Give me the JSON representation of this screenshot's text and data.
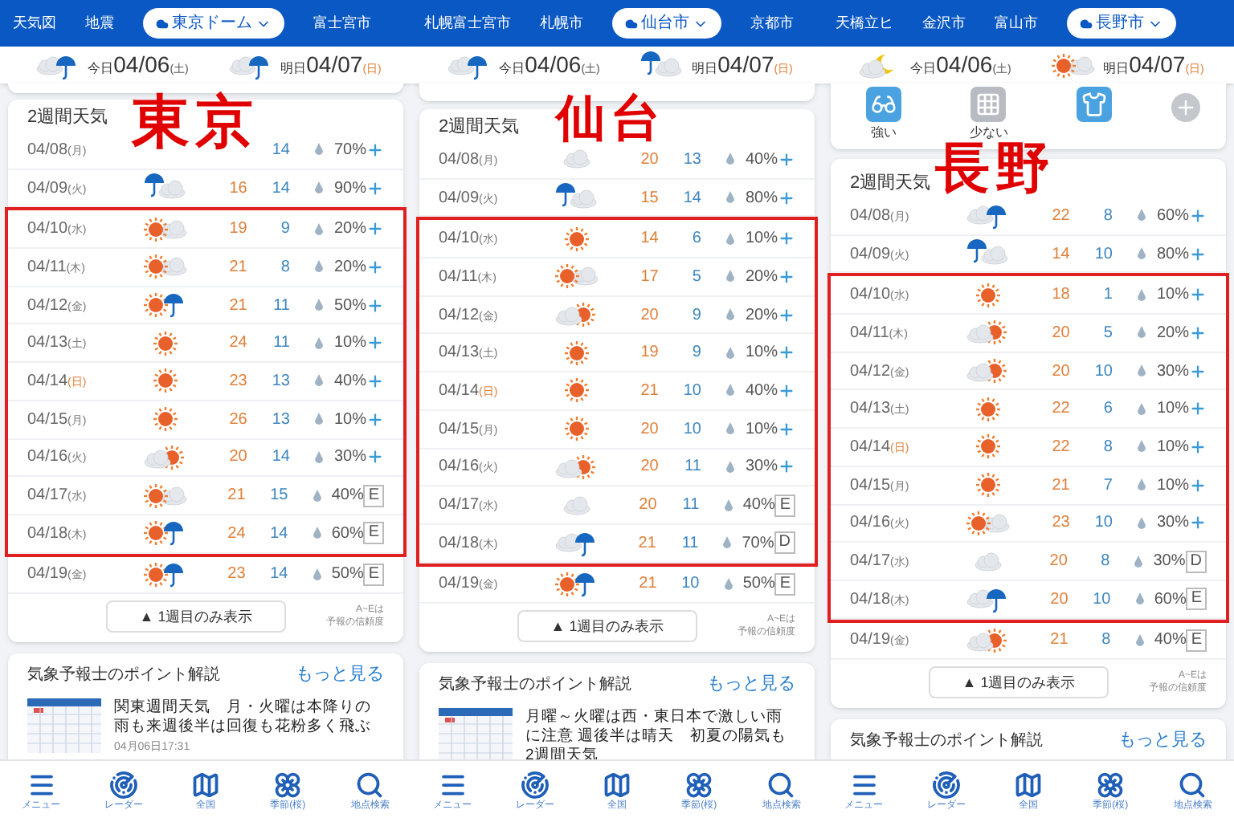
{
  "columns": [
    {
      "city_label": "東京",
      "tabs": [
        {
          "label": "天気図",
          "selected": false
        },
        {
          "label": "地震",
          "selected": false
        },
        {
          "label": "東京ドーム",
          "selected": true
        },
        {
          "label": "富士宮市",
          "selected": false
        }
      ],
      "days": [
        {
          "label": "今日",
          "date": "04/06",
          "weekday": "(土)",
          "holiday": false,
          "kind": "cloud-rain"
        },
        {
          "label": "明日",
          "date": "04/07",
          "weekday": "(日)",
          "holiday": true,
          "kind": "cloud-rain"
        }
      ],
      "forecast": {
        "title": "2週間天気",
        "toggle": "▲ 1週目のみ表示",
        "note": [
          "A~Eは",
          "予報の信頼度"
        ],
        "rows": [
          {
            "date": "04/08",
            "weekday": "(月)",
            "holiday": false,
            "low": "14",
            "rain": "70%"
          },
          {
            "date": "04/09",
            "weekday": "(火)",
            "holiday": false,
            "kind": "rain-cloud",
            "high": "16",
            "low": "14",
            "rain": "90%"
          }
        ],
        "highlighted_rows": [
          {
            "date": "04/10",
            "weekday": "(水)",
            "holiday": false,
            "kind": "sun-cloud",
            "high": "19",
            "low": "9",
            "rain": "20%"
          },
          {
            "date": "04/11",
            "weekday": "(木)",
            "holiday": false,
            "kind": "sun-cloud",
            "high": "21",
            "low": "8",
            "rain": "20%"
          },
          {
            "date": "04/12",
            "weekday": "(金)",
            "holiday": false,
            "kind": "sun-rain",
            "high": "21",
            "low": "11",
            "rain": "50%"
          },
          {
            "date": "04/13",
            "weekday": "(土)",
            "holiday": false,
            "kind": "sun",
            "high": "24",
            "low": "11",
            "rain": "10%"
          },
          {
            "date": "04/14",
            "weekday": "(日)",
            "holiday": true,
            "kind": "sun",
            "high": "23",
            "low": "13",
            "rain": "40%"
          },
          {
            "date": "04/15",
            "weekday": "(月)",
            "holiday": false,
            "kind": "sun",
            "high": "26",
            "low": "13",
            "rain": "10%"
          },
          {
            "date": "04/16",
            "weekday": "(火)",
            "holiday": false,
            "kind": "cloud-sun",
            "high": "20",
            "low": "14",
            "rain": "30%"
          },
          {
            "date": "04/17",
            "weekday": "(水)",
            "holiday": false,
            "kind": "sun-cloud",
            "high": "21",
            "low": "15",
            "rain": "40%",
            "grade": "E"
          },
          {
            "date": "04/18",
            "weekday": "(木)",
            "holiday": false,
            "kind": "sun-rain",
            "high": "24",
            "low": "14",
            "rain": "60%",
            "grade": "E"
          }
        ],
        "later_rows": [
          {
            "date": "04/19",
            "weekday": "(金)",
            "holiday": false,
            "kind": "sun-rain",
            "high": "23",
            "low": "14",
            "rain": "50%",
            "grade": "E"
          }
        ]
      },
      "points": {
        "title": "気象予報士のポイント解説",
        "more": "もっと見る",
        "article": {
          "title": "関東週間天気　月・火曜は本降りの雨も来週後半は回復も花粉多く飛ぶ",
          "date": "04月06日17:31"
        }
      },
      "nav": [
        {
          "label": "メニュー",
          "kind": "menu"
        },
        {
          "label": "レーダー",
          "kind": "radar"
        },
        {
          "label": "全国",
          "kind": "map"
        },
        {
          "label": "季節(桜)",
          "kind": "flower"
        },
        {
          "label": "地点検索",
          "kind": "search"
        }
      ]
    },
    {
      "city_label": "仙台",
      "tabs": [
        {
          "label": "札幌富士宮市",
          "selected": false
        },
        {
          "label": "札幌市",
          "selected": false
        },
        {
          "label": "仙台市",
          "selected": true
        },
        {
          "label": "京都市",
          "selected": false
        }
      ],
      "days": [
        {
          "label": "今日",
          "date": "04/06",
          "weekday": "(土)",
          "holiday": false,
          "kind": "cloud-rain"
        },
        {
          "label": "明日",
          "date": "04/07",
          "weekday": "(日)",
          "holiday": true,
          "kind": "rain-cloud"
        }
      ],
      "forecast": {
        "title": "2週間天気",
        "toggle": "▲ 1週目のみ表示",
        "note": [
          "A~Eは",
          "予報の信頼度"
        ],
        "rows": [
          {
            "date": "04/08",
            "weekday": "(月)",
            "holiday": false,
            "kind": "cloud",
            "high": "20",
            "low": "13",
            "rain": "40%"
          },
          {
            "date": "04/09",
            "weekday": "(火)",
            "holiday": false,
            "kind": "rain-cloud",
            "high": "15",
            "low": "14",
            "rain": "80%"
          }
        ],
        "highlighted_rows": [
          {
            "date": "04/10",
            "weekday": "(水)",
            "holiday": false,
            "kind": "sun",
            "high": "14",
            "low": "6",
            "rain": "10%"
          },
          {
            "date": "04/11",
            "weekday": "(木)",
            "holiday": false,
            "kind": "sun-cloud",
            "high": "17",
            "low": "5",
            "rain": "20%"
          },
          {
            "date": "04/12",
            "weekday": "(金)",
            "holiday": false,
            "kind": "cloud-sun",
            "high": "20",
            "low": "9",
            "rain": "20%"
          },
          {
            "date": "04/13",
            "weekday": "(土)",
            "holiday": false,
            "kind": "sun",
            "high": "19",
            "low": "9",
            "rain": "10%"
          },
          {
            "date": "04/14",
            "weekday": "(日)",
            "holiday": true,
            "kind": "sun",
            "high": "21",
            "low": "10",
            "rain": "40%"
          },
          {
            "date": "04/15",
            "weekday": "(月)",
            "holiday": false,
            "kind": "sun",
            "high": "20",
            "low": "10",
            "rain": "10%"
          },
          {
            "date": "04/16",
            "weekday": "(火)",
            "holiday": false,
            "kind": "cloud-sun",
            "high": "20",
            "low": "11",
            "rain": "30%"
          },
          {
            "date": "04/17",
            "weekday": "(水)",
            "holiday": false,
            "kind": "cloud",
            "high": "20",
            "low": "11",
            "rain": "40%",
            "grade": "E"
          },
          {
            "date": "04/18",
            "weekday": "(木)",
            "holiday": false,
            "kind": "cloud-rain",
            "high": "21",
            "low": "11",
            "rain": "70%",
            "grade": "D"
          }
        ],
        "later_rows": [
          {
            "date": "04/19",
            "weekday": "(金)",
            "holiday": false,
            "kind": "sun-rain",
            "high": "21",
            "low": "10",
            "rain": "50%",
            "grade": "E"
          }
        ]
      },
      "points": {
        "title": "気象予報士のポイント解説",
        "more": "もっと見る",
        "article": {
          "title": "月曜～火曜は西・東日本で激しい雨に注意 週後半は晴天　初夏の陽気も　2週間天気"
        }
      },
      "nav": [
        {
          "label": "メニュー",
          "kind": "menu"
        },
        {
          "label": "レーダー",
          "kind": "radar"
        },
        {
          "label": "全国",
          "kind": "map"
        },
        {
          "label": "季節(桜)",
          "kind": "flower"
        },
        {
          "label": "地点検索",
          "kind": "search"
        }
      ]
    },
    {
      "city_label": "長野",
      "tabs": [
        {
          "label": "天橋立ヒ",
          "selected": false
        },
        {
          "label": "金沢市",
          "selected": false
        },
        {
          "label": "富山市",
          "selected": false
        },
        {
          "label": "長野市",
          "selected": true
        }
      ],
      "days": [
        {
          "label": "今日",
          "date": "04/06",
          "weekday": "(土)",
          "holiday": false,
          "kind": "cloud-moon"
        },
        {
          "label": "明日",
          "date": "04/07",
          "weekday": "(日)",
          "holiday": true,
          "kind": "sun-cloud"
        }
      ],
      "indices": [
        {
          "kind": "glasses",
          "label": "強い"
        },
        {
          "kind": "haze",
          "label": "少ない"
        },
        {
          "kind": "shirt"
        },
        {
          "kind": "add"
        }
      ],
      "forecast": {
        "title": "2週間天気",
        "toggle": "▲ 1週目のみ表示",
        "note": [
          "A~Eは",
          "予報の信頼度"
        ],
        "rows": [
          {
            "date": "04/08",
            "weekday": "(月)",
            "holiday": false,
            "kind": "cloud-rain",
            "high": "22",
            "low": "8",
            "rain": "60%"
          },
          {
            "date": "04/09",
            "weekday": "(火)",
            "holiday": false,
            "kind": "rain-cloud",
            "high": "14",
            "low": "10",
            "rain": "80%"
          }
        ],
        "highlighted_rows": [
          {
            "date": "04/10",
            "weekday": "(水)",
            "holiday": false,
            "kind": "sun",
            "high": "18",
            "low": "1",
            "rain": "10%"
          },
          {
            "date": "04/11",
            "weekday": "(木)",
            "holiday": false,
            "kind": "cloud-sun",
            "high": "20",
            "low": "5",
            "rain": "20%"
          },
          {
            "date": "04/12",
            "weekday": "(金)",
            "holiday": false,
            "kind": "cloud-sun",
            "high": "20",
            "low": "10",
            "rain": "30%"
          },
          {
            "date": "04/13",
            "weekday": "(土)",
            "holiday": false,
            "kind": "sun",
            "high": "22",
            "low": "6",
            "rain": "10%"
          },
          {
            "date": "04/14",
            "weekday": "(日)",
            "holiday": true,
            "kind": "sun",
            "high": "22",
            "low": "8",
            "rain": "10%"
          },
          {
            "date": "04/15",
            "weekday": "(月)",
            "holiday": false,
            "kind": "sun",
            "high": "21",
            "low": "7",
            "rain": "10%"
          },
          {
            "date": "04/16",
            "weekday": "(火)",
            "holiday": false,
            "kind": "sun-cloud",
            "high": "23",
            "low": "10",
            "rain": "30%"
          },
          {
            "date": "04/17",
            "weekday": "(水)",
            "holiday": false,
            "kind": "cloud",
            "high": "20",
            "low": "8",
            "rain": "30%",
            "grade": "D"
          },
          {
            "date": "04/18",
            "weekday": "(木)",
            "holiday": false,
            "kind": "cloud-rain",
            "high": "20",
            "low": "10",
            "rain": "60%",
            "grade": "E"
          }
        ],
        "later_rows": [
          {
            "date": "04/19",
            "weekday": "(金)",
            "holiday": false,
            "kind": "cloud-sun",
            "high": "21",
            "low": "8",
            "rain": "40%",
            "grade": "E"
          }
        ]
      },
      "points": {
        "title": "気象予報士のポイント解説",
        "more": "もっと見る"
      },
      "nav": [
        {
          "label": "メニュー",
          "kind": "menu"
        },
        {
          "label": "レーダー",
          "kind": "radar"
        },
        {
          "label": "全国",
          "kind": "map"
        },
        {
          "label": "季節(桜)",
          "kind": "flower"
        },
        {
          "label": "地点検索",
          "kind": "search"
        }
      ]
    }
  ]
}
